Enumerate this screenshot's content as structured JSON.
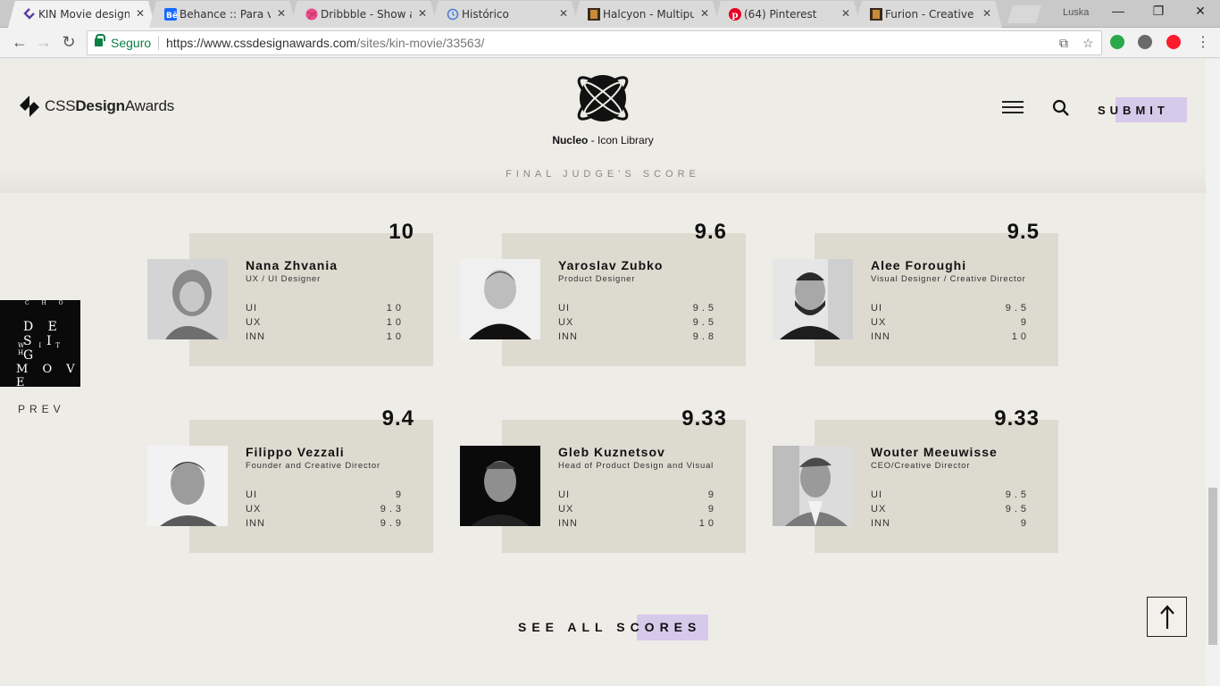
{
  "browser": {
    "tabs": [
      {
        "title": "KIN Movie designer",
        "active": true,
        "favicon": "cssda-icon"
      },
      {
        "title": "Behance :: Para você",
        "active": false,
        "favicon": "behance-icon"
      },
      {
        "title": "Dribbble - Show and tell",
        "active": false,
        "favicon": "dribbble-icon"
      },
      {
        "title": "Histórico",
        "active": false,
        "favicon": "history-icon"
      },
      {
        "title": "Halcyon - Multipurpose",
        "active": false,
        "favicon": "themeforest-icon"
      },
      {
        "title": "(64) Pinterest",
        "active": false,
        "favicon": "pinterest-icon"
      },
      {
        "title": "Furion - Creative Portfolio",
        "active": false,
        "favicon": "themeforest-icon"
      }
    ],
    "profile": "Luska",
    "secure_label": "Seguro",
    "url_host": "https://www.cssdesignawards.com",
    "url_path": "/sites/kin-movie/33563/"
  },
  "header": {
    "logo_prefix": "CSS",
    "logo_bold": "Design",
    "logo_suffix": "Awards",
    "ad_name": "Nucleo",
    "ad_suffix": " - Icon Library",
    "submit_label": "SUBMIT"
  },
  "section_title": "FINAL JUDGE'S SCORE",
  "sidebar": {
    "prev_label": "PREV",
    "thumb_words": [
      "C H O",
      "D E S I G",
      "W I T H",
      "M O V E"
    ]
  },
  "judges": [
    {
      "score": "10",
      "name": "Nana Zhvania",
      "role": "UX / UI Designer",
      "rows": [
        {
          "k": "UI",
          "v": "10"
        },
        {
          "k": "UX",
          "v": "10"
        },
        {
          "k": "INN",
          "v": "10"
        }
      ]
    },
    {
      "score": "9.6",
      "name": "Yaroslav Zubko",
      "role": "Product Designer",
      "rows": [
        {
          "k": "UI",
          "v": "9.5"
        },
        {
          "k": "UX",
          "v": "9.5"
        },
        {
          "k": "INN",
          "v": "9.8"
        }
      ]
    },
    {
      "score": "9.5",
      "name": "Alee Foroughi",
      "role": "Visual Designer / Creative Director",
      "rows": [
        {
          "k": "UI",
          "v": "9.5"
        },
        {
          "k": "UX",
          "v": "9"
        },
        {
          "k": "INN",
          "v": "10"
        }
      ]
    },
    {
      "score": "9.4",
      "name": "Filippo Vezzali",
      "role": "Founder and Creative Director",
      "rows": [
        {
          "k": "UI",
          "v": "9"
        },
        {
          "k": "UX",
          "v": "9.3"
        },
        {
          "k": "INN",
          "v": "9.9"
        }
      ]
    },
    {
      "score": "9.33",
      "name": "Gleb Kuznetsov",
      "role": "Head of Product Design and Visual",
      "rows": [
        {
          "k": "UI",
          "v": "9"
        },
        {
          "k": "UX",
          "v": "9"
        },
        {
          "k": "INN",
          "v": "10"
        }
      ]
    },
    {
      "score": "9.33",
      "name": "Wouter Meeuwisse",
      "role": "CEO/Creative Director",
      "rows": [
        {
          "k": "UI",
          "v": "9.5"
        },
        {
          "k": "UX",
          "v": "9.5"
        },
        {
          "k": "INN",
          "v": "9"
        }
      ]
    }
  ],
  "see_all_label": "SEE ALL SCORES",
  "colors": {
    "accent": "#d7c9ea",
    "card": "#dddad0",
    "page": "#eeece7",
    "secure": "#0b8043"
  }
}
